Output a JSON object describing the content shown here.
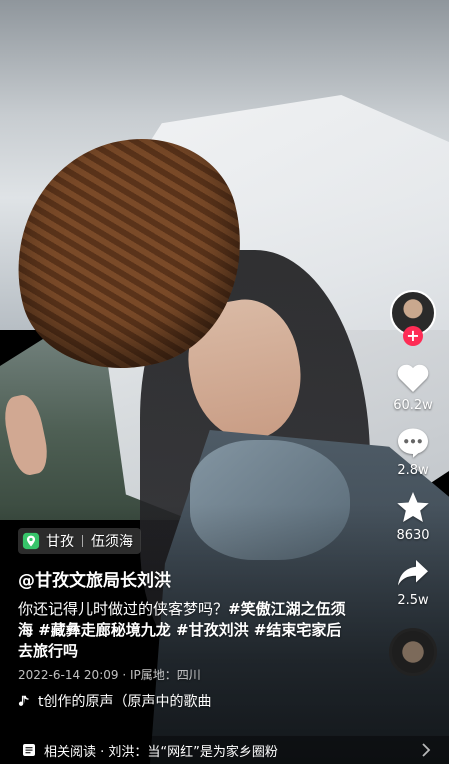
{
  "rail": {
    "likes": "60.2w",
    "comments": "2.8w",
    "favorites": "8630",
    "shares": "2.5w",
    "follow_label": "+"
  },
  "info": {
    "location": "甘孜",
    "place": "伍须海",
    "author": "@甘孜文旅局长刘洪",
    "desc_text": "你还记得儿时做过的侠客梦吗？",
    "desc_tags": "#笑傲江湖之伍须海 #藏彝走廊秘境九龙 #甘孜刘洪 #结束宅家后去旅行吗",
    "meta": "2022-6-14 20:09 · IP属地：四川",
    "music": "t创作的原声（原声中的歌曲"
  },
  "related": {
    "text": "相关阅读 · 刘洪：当“网红”是为家乡圈粉"
  },
  "colors": {
    "accent": "#fe2c55",
    "text": "#ffffff"
  },
  "icons": [
    "location-icon",
    "heart-icon",
    "comment-icon",
    "star-icon",
    "share-icon",
    "music-note-icon",
    "article-icon",
    "chevron-right-icon"
  ]
}
